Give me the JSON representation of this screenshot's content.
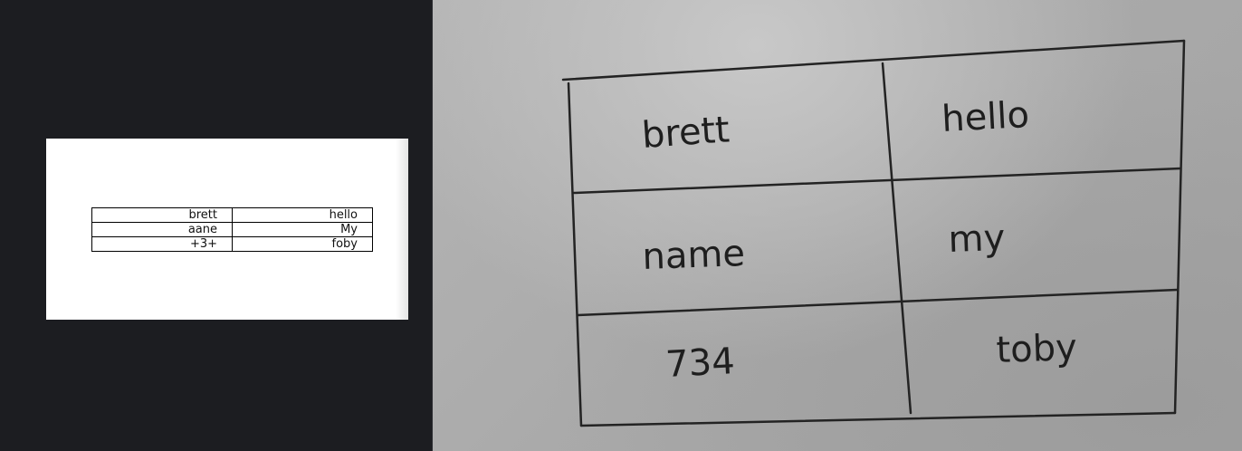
{
  "preview": {
    "table": {
      "rows": [
        [
          "brett",
          "hello"
        ],
        [
          "aane",
          "My"
        ],
        [
          "+3+",
          "foby"
        ]
      ]
    }
  },
  "photo": {
    "handwritten_table": {
      "rows": [
        [
          "brett",
          "hello"
        ],
        [
          "name",
          "my"
        ],
        [
          "734",
          "toby"
        ]
      ]
    }
  }
}
